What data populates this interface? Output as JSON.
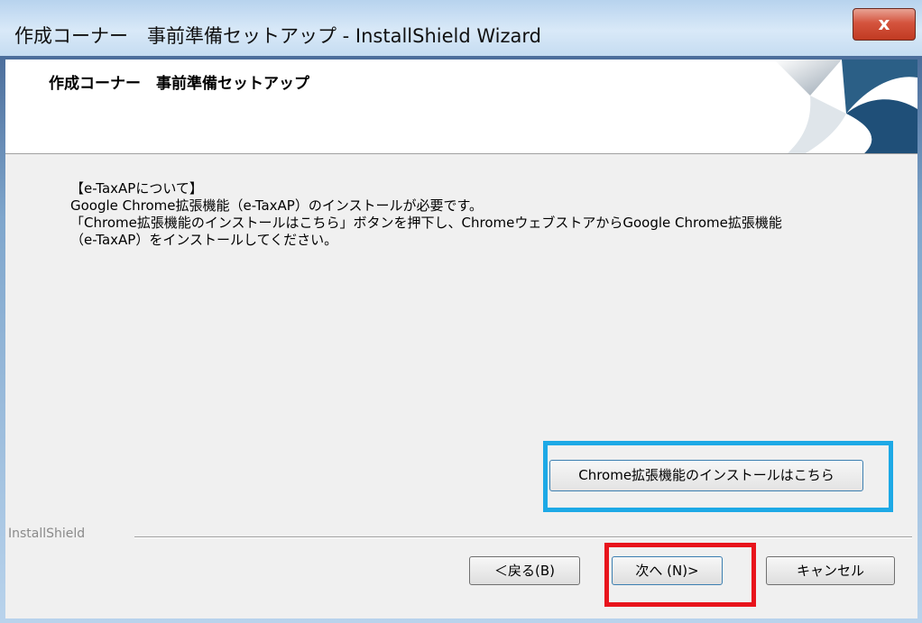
{
  "window": {
    "title": "作成コーナー　事前準備セットアップ - InstallShield Wizard",
    "close_label": "x"
  },
  "header": {
    "title": "作成コーナー　事前準備セットアップ"
  },
  "body": {
    "lines": [
      "【e-TaxAPについて】",
      "Google Chrome拡張機能（e-TaxAP）のインストールが必要です。",
      "「Chrome拡張機能のインストールはこちら」ボタンを押下し、ChromeウェブストアからGoogle Chrome拡張機能",
      "（e-TaxAP）をインストールしてください。"
    ]
  },
  "chrome_button": {
    "label": "Chrome拡張機能のインストールはこちら"
  },
  "footer": {
    "brand": "InstallShield",
    "back_label": "＜戻る(B)",
    "next_label": "次へ (N)>",
    "cancel_label": "キャンセル"
  },
  "colors": {
    "highlight_blue": "#1da9e6",
    "highlight_red": "#e8141c"
  }
}
